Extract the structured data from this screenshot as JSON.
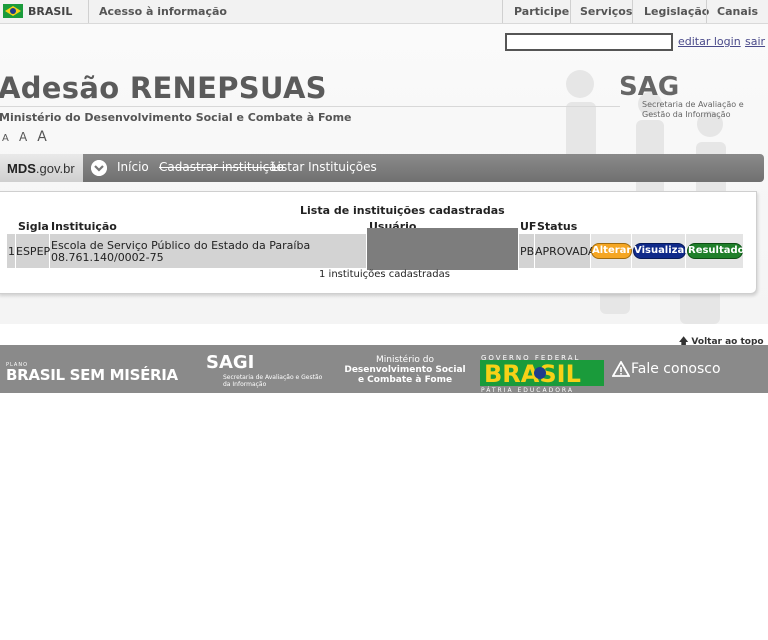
{
  "gov_bar": {
    "country": "BRASIL",
    "access_info": "Acesso à informação",
    "links": [
      "Participe",
      "Serviços",
      "Legislação",
      "Canais"
    ]
  },
  "login": {
    "input_value": "",
    "edit_label": "editar login",
    "logout_label": "sair"
  },
  "site": {
    "title": "Adesão RENEPSUAS",
    "ministry": "Ministério do Desenvolvimento Social e Combate à Fome",
    "font_sizes": [
      "A",
      "A",
      "A"
    ]
  },
  "sagi": {
    "name": "SAGI",
    "description": "Secretaria de Avaliação e Gestão da Informação"
  },
  "nav": {
    "logo_main": "MDS",
    "logo_suffix": ".gov.br",
    "items": [
      "Início",
      "Cadastrar instituição",
      "Listar Instituições"
    ]
  },
  "table": {
    "title": "Lista de instituições cadastradas",
    "headers": [
      "Sigla",
      "Instituição",
      "Usuário",
      "UF",
      "Status"
    ],
    "rows": [
      {
        "index": "1",
        "sigla": "ESPEP",
        "instituicao": "Escola de Serviço Público do Estado da Paraíba",
        "cnpj": "08.761.140/0002-75",
        "uf": "PB",
        "status": "APROVADA"
      }
    ],
    "actions": [
      "Alterar",
      "Visualizar",
      "Resultado"
    ],
    "count_text": "1 instituições cadastradas"
  },
  "back_to_top": "Voltar ao topo",
  "footer": {
    "plano": "PLANO",
    "brasil_sem_miseria": "BRASIL SEM MISÉRIA",
    "sagi": "SAGI",
    "sagi_sub": "Secretaria de Avaliação e Gestão da Informação",
    "ministry_line1": "Ministério do",
    "ministry_line2": "Desenvolvimento Social e Combate à Fome",
    "gov_federal": "GOVERNO FEDERAL",
    "brasil": "BRASIL",
    "patria": "PÁTRIA EDUCADORA",
    "fale_conosco": "Fale conosco"
  },
  "colors": {
    "nav_bg": "#7c7c7c",
    "alterar": "#f5a623",
    "visualizar": "#102a8a",
    "resultado": "#1f7f2a"
  }
}
